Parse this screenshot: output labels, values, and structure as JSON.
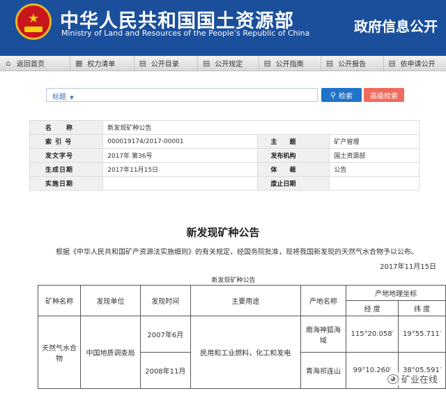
{
  "header": {
    "title_cn": "中华人民共和国国土资源部",
    "title_en": "Ministry of Land and Resources of the People’s Republic of China",
    "right_title": "政府信息公开"
  },
  "nav": {
    "items": [
      {
        "label": "返回首页",
        "icon": "home-icon"
      },
      {
        "label": "权力清单",
        "icon": "power-list-icon"
      },
      {
        "label": "公开目录",
        "icon": "document-icon"
      },
      {
        "label": "公开规定",
        "icon": "document-icon"
      },
      {
        "label": "公开指南",
        "icon": "document-icon"
      },
      {
        "label": "公开报告",
        "icon": "report-icon"
      },
      {
        "label": "依申请公开",
        "icon": "document-icon"
      }
    ]
  },
  "search": {
    "select_label": "标题",
    "select_arrow": "▼",
    "search_button": "检索",
    "advanced_button": "高级检索"
  },
  "meta": {
    "name_label": "名　　称",
    "name_value": "新发现矿种公告",
    "index_label": "索 引 号",
    "index_value": "000019174/2017-00001",
    "subject_label": "主　　题",
    "subject_value": "矿产管理",
    "doc_no_label": "发文字号",
    "doc_no_value": "2017年 第36号",
    "issuer_label": "发布机构",
    "issuer_value": "国土资源部",
    "created_label": "生成日期",
    "created_value": "2017年11月15日",
    "genre_label": "体　　裁",
    "genre_value": "公告",
    "effective_label": "实施日期",
    "effective_value": "",
    "expire_label": "废止日期",
    "expire_value": ""
  },
  "doc": {
    "title": "新发现矿种公告",
    "paragraph": "根据《中华人民共和国矿产资源法实施细则》的有关规定，经国务院批准，现将我国新发现的天然气水合物予以公布。",
    "date": "2017年11月15日",
    "table_caption": "新发现矿种公告"
  },
  "mineral_table": {
    "headers": {
      "mineral": "矿种名称",
      "discoverer": "发现单位",
      "discovery_time": "发现时间",
      "usage": "主要用途",
      "location": "产地名称",
      "coords": "产地地理坐标",
      "longitude": "经 度",
      "latitude": "纬 度"
    },
    "rows": [
      {
        "mineral": "天然气水合物",
        "discoverer": "中国地质调查局",
        "time": "2007年6月",
        "usage": "民用和工业燃料，化工和发电",
        "location": "南海神狐海域",
        "longitude": "115°20.058′",
        "latitude": "19°55.711′"
      },
      {
        "time": "2008年11月",
        "location": "青海祁连山",
        "longitude": "99°10.260′",
        "latitude": "38°05.591′"
      }
    ]
  },
  "watermark": {
    "text": "矿业在线"
  }
}
